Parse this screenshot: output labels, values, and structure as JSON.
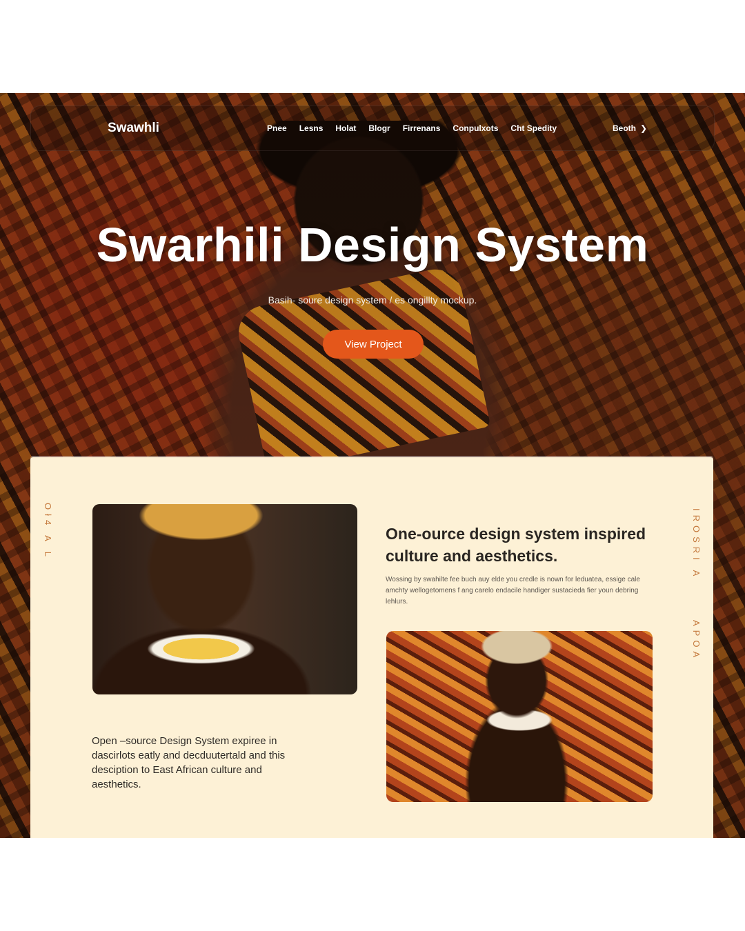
{
  "nav": {
    "brand": "Swawhli",
    "links": [
      "Pnee",
      "Lesns",
      "Holat",
      "Blogr",
      "Firrenans",
      "Conpulxots",
      "Cht Spedity"
    ],
    "cta_label": "Beoth",
    "cta_icon": "chevron-right-icon"
  },
  "hero": {
    "title": "Swarhili Design System",
    "subtitle": "Basih- soure design system / es ongillty mockup.",
    "button_label": "View Project",
    "button_color": "#e4571b"
  },
  "panel": {
    "vertical_left": "Oł4 A L",
    "vertical_right_top": "IROSRI A",
    "vertical_right_bottom": "APOA",
    "heading": "One-ource design system inspired culture and aesthetics.",
    "paragraph": "Wossing by swahilte fee buch auy elde you credle is nown for leduatea, essige cale amchty wellogetomens f ang carelo endacile handiger sustacieda fier youn debring lehlurs.",
    "body_text": "Open –source Design System expiree in dascirlots eatly and decduutertald and this desciption to East African culture and aesthetics.",
    "background_color": "#fdf1d6"
  }
}
